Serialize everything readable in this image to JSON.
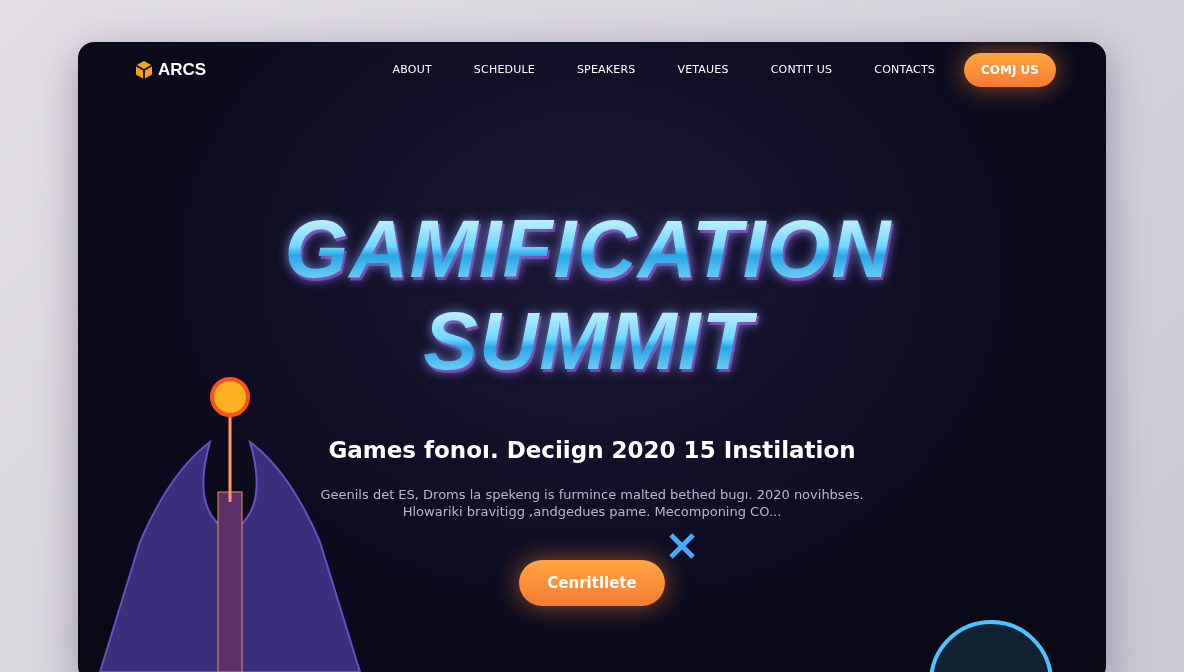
{
  "brand": {
    "name": "ARCS"
  },
  "nav": [
    {
      "label": "ABOUT"
    },
    {
      "label": "SCHEDULE"
    },
    {
      "label": "SPEAKERS"
    },
    {
      "label": "VETAUES"
    },
    {
      "label": "CONTIT US"
    },
    {
      "label": "CONTACTS"
    }
  ],
  "nav_button": {
    "label": "COMJ US"
  },
  "hero": {
    "title_lines": [
      "GAMIFICATION",
      "SUMMIT"
    ],
    "subtitle": "Games fonoı. Deciign 2020 15 Instilation",
    "description_lines": [
      "Geenils det ES, Droms la spekeng is furmince malted bethed bugı. 2020 novihbses.",
      "Hlowariki bravitigg ,andgedues pame. Mecomponing CO..."
    ],
    "button": {
      "label": "Cenritllete"
    }
  }
}
